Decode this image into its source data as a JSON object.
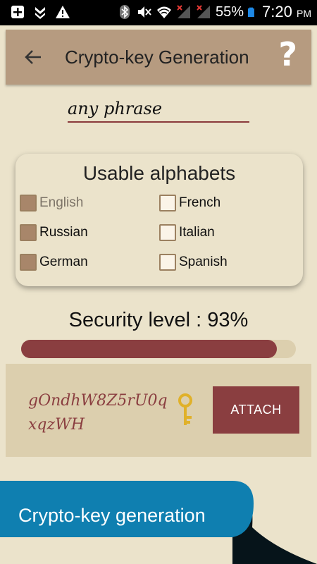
{
  "status_bar": {
    "battery": "55%",
    "time": "7:20",
    "ampm": "PM"
  },
  "app_bar": {
    "title": "Crypto-key Generation",
    "help_label": "?"
  },
  "phrase_input": {
    "value": "any phrase"
  },
  "alphabets": {
    "title": "Usable alphabets",
    "items": [
      {
        "label": "English",
        "checked": true,
        "disabled": true
      },
      {
        "label": "French",
        "checked": false,
        "disabled": false
      },
      {
        "label": "Russian",
        "checked": true,
        "disabled": false
      },
      {
        "label": "Italian",
        "checked": false,
        "disabled": false
      },
      {
        "label": "German",
        "checked": true,
        "disabled": false
      },
      {
        "label": "Spanish",
        "checked": false,
        "disabled": false
      }
    ]
  },
  "security": {
    "text": "Security level : 93%",
    "level": 0.93
  },
  "key_panel": {
    "key": "gOndhW8Z5rU0qxqzWH",
    "attach_label": "ATTACH"
  },
  "banner": {
    "text": "Crypto-key generation"
  },
  "colors": {
    "background": "#ebe3cb",
    "app_bar": "#b69b80",
    "accent": "#8a3e40",
    "panel": "#dccfae",
    "banner": "#0f7fb0",
    "key_icon": "#e0b12a"
  }
}
